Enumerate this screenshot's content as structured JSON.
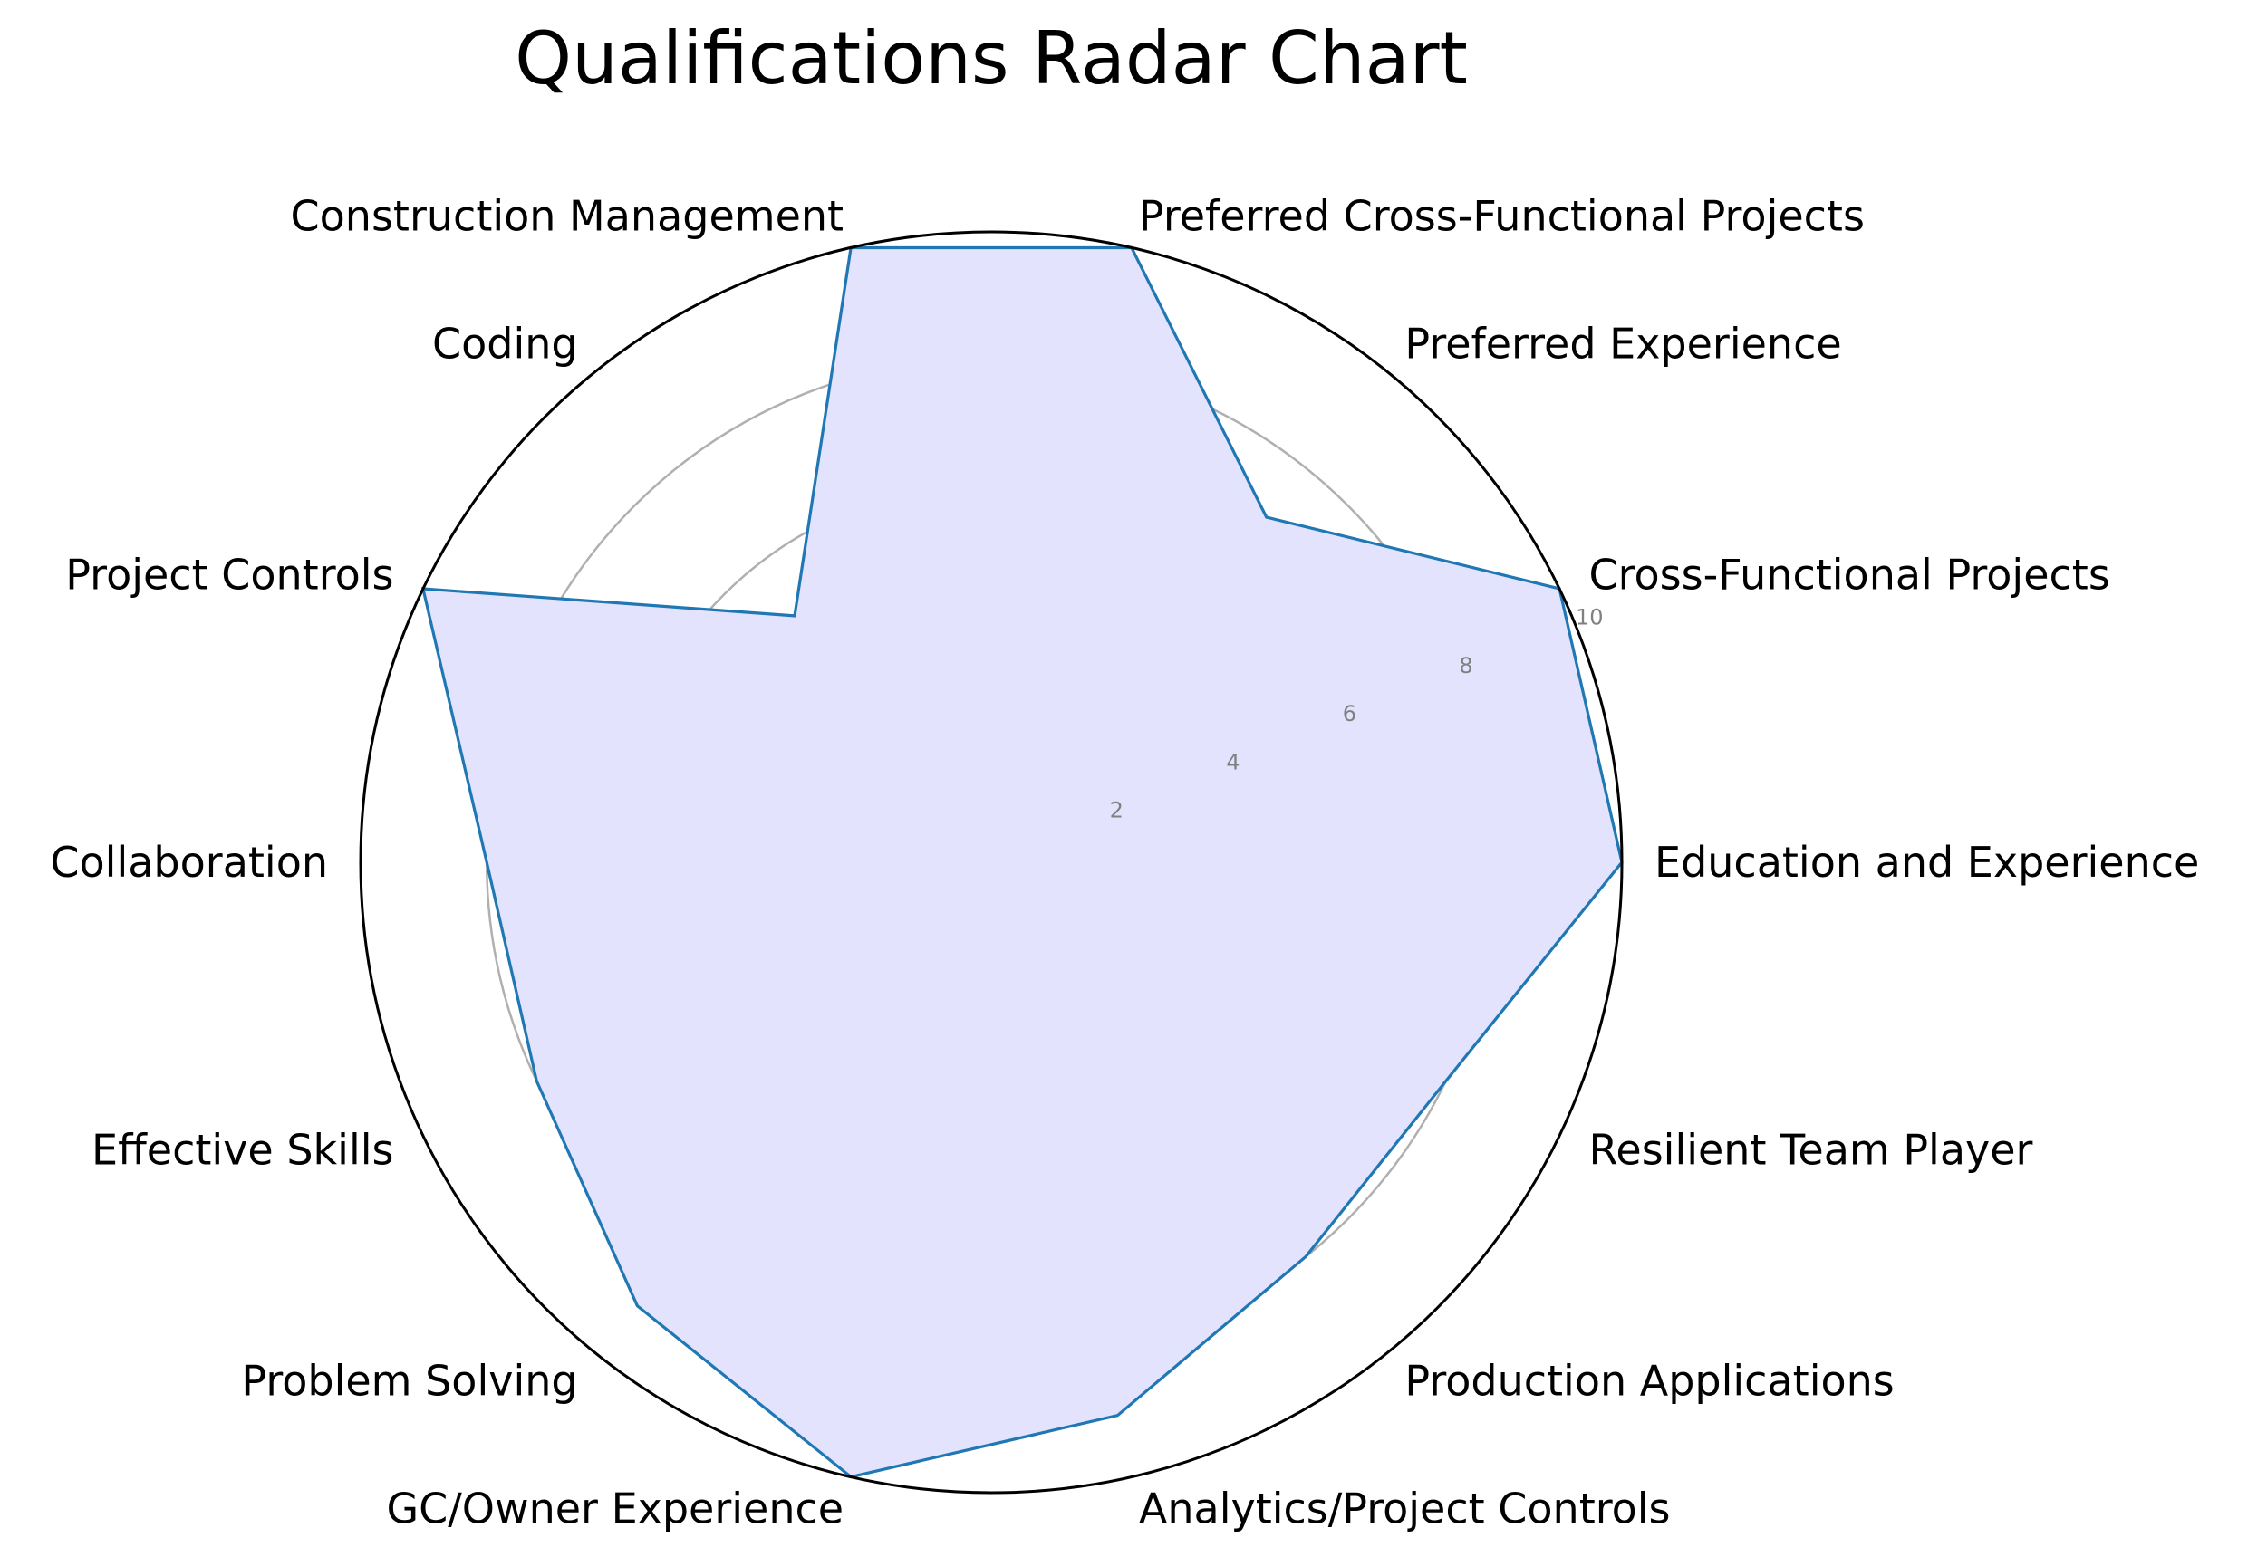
{
  "chart_data": {
    "type": "radar",
    "title": "Qualifications Radar Chart",
    "categories": [
      "Education and Experience",
      "Cross-Functional Projects",
      "Preferred Experience",
      "Preferred Cross-Functional Projects",
      "Construction Management",
      "Coding",
      "Project Controls",
      "Collaboration",
      "Effective Skills",
      "Problem Solving",
      "GC/Owner Experience",
      "Analytics/Project Controls",
      "Production Applications",
      "Resilient Team Player"
    ],
    "series": [
      {
        "values": [
          10,
          10,
          7,
          10,
          10,
          5,
          10,
          8,
          8,
          9,
          10,
          9,
          8,
          8
        ]
      }
    ],
    "rlim": [
      0,
      10
    ],
    "rticks": [
      2,
      4,
      6,
      8,
      10
    ],
    "rtick_labels": [
      "2",
      "4",
      "6",
      "8",
      "10"
    ],
    "grid": true,
    "colors": {
      "line": "#1f77b4",
      "fill": "#e3e3fd",
      "grid": "#b0b0b0",
      "frame": "#000000",
      "tick_label": "#808080"
    }
  }
}
